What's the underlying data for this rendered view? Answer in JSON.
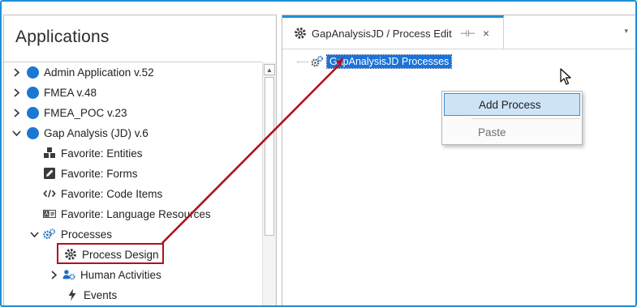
{
  "left": {
    "title": "Applications",
    "items": [
      {
        "label": "Admin Application v.52",
        "icon": "blue-circle-icon",
        "expand": "collapsed"
      },
      {
        "label": "FMEA v.48",
        "icon": "blue-circle-icon",
        "expand": "collapsed"
      },
      {
        "label": "FMEA_POC v.23",
        "icon": "blue-circle-icon",
        "expand": "collapsed"
      },
      {
        "label": "Gap Analysis (JD) v.6",
        "icon": "blue-circle-icon",
        "expand": "expanded"
      },
      {
        "label": "Favorite: Entities",
        "icon": "entities-icon"
      },
      {
        "label": "Favorite: Forms",
        "icon": "forms-icon"
      },
      {
        "label": "Favorite: Code Items",
        "icon": "code-icon"
      },
      {
        "label": "Favorite: Language Resources",
        "icon": "language-icon"
      },
      {
        "label": "Processes",
        "icon": "gears-icon",
        "expand": "expanded"
      },
      {
        "label": "Process Design",
        "icon": "gear-icon"
      },
      {
        "label": "Human Activities",
        "icon": "users-gear-icon",
        "expand": "collapsed"
      },
      {
        "label": "Events",
        "icon": "lightning-icon"
      }
    ]
  },
  "tab": {
    "label": "GapAnalysisJD / Process Edit",
    "pin_glyph": "⊣⊢",
    "close_glyph": "×",
    "dropdown_glyph": "▾"
  },
  "tree_node": {
    "label": "GapAnalysisJD Processes"
  },
  "context_menu": {
    "items": [
      {
        "label": "Add Process",
        "state": "hover"
      },
      {
        "label": "Paste",
        "state": "disabled"
      }
    ]
  },
  "colors": {
    "accent": "#1f8fd6",
    "node_blue": "#1978d4",
    "selection": "#1a73d8",
    "menu_hover": "#cde4f7",
    "annotation_red": "#b1121b"
  }
}
